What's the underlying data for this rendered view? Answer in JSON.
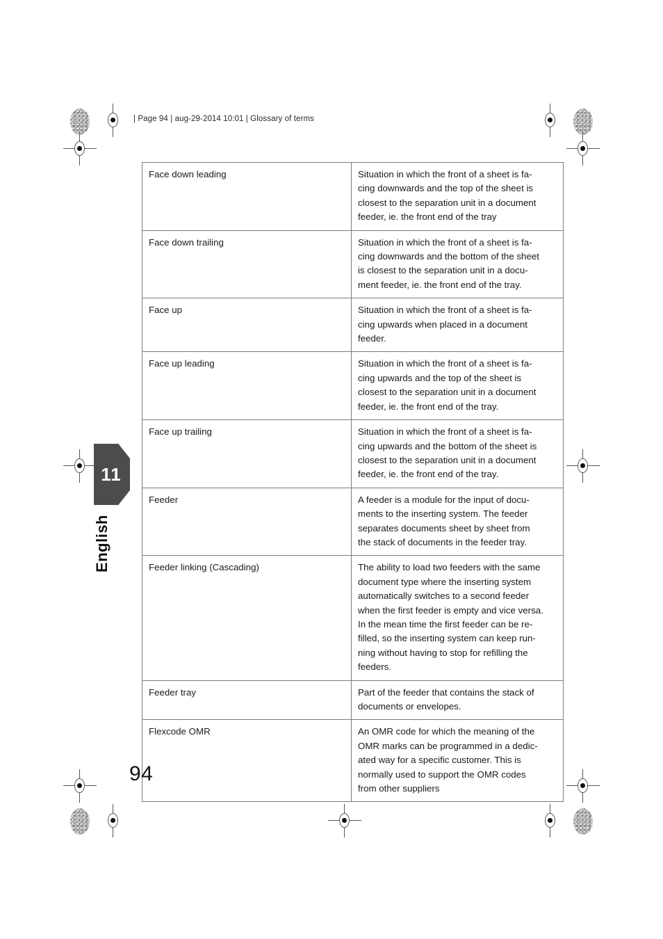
{
  "document": {
    "running_header": "|  Page 94 | aug-29-2014 10:01 | Glossary of terms",
    "page_number": "94",
    "chapter_number": "11",
    "language_tab": "English",
    "accent_color": "#4c4c4e",
    "rule_color": "#7c7c7c"
  },
  "glossary": {
    "rows": [
      {
        "term": "Face down leading",
        "definition_lines": [
          "Situation in which the front of a sheet is fa-",
          "cing downwards and the top of the sheet is",
          "closest to the separation unit in a document",
          "feeder, ie. the front end of the tray"
        ]
      },
      {
        "term": "Face down trailing",
        "definition_lines": [
          "Situation in which the front of a sheet is fa-",
          "cing downwards and the bottom of the sheet",
          "is closest to the separation unit in a docu-",
          "ment feeder, ie. the front end of the tray."
        ]
      },
      {
        "term": "Face up",
        "definition_lines": [
          "Situation in which the front of a sheet is fa-",
          "cing upwards when placed in a document",
          "feeder."
        ]
      },
      {
        "term": "Face up leading",
        "definition_lines": [
          "Situation in which the front of a sheet is fa-",
          "cing upwards and the top of the sheet is",
          "closest to the separation unit in a document",
          "feeder, ie. the front end of the tray."
        ]
      },
      {
        "term": "Face up trailing",
        "definition_lines": [
          "Situation in which the front of a sheet is fa-",
          "cing upwards and the bottom of the sheet is",
          "closest to the separation unit in a document",
          "feeder, ie. the front end of the tray."
        ]
      },
      {
        "term": "Feeder",
        "definition_lines": [
          "A feeder is a module for the input of docu-",
          "ments to the inserting system. The feeder",
          "separates documents sheet by sheet from",
          "the stack of documents in the feeder tray."
        ]
      },
      {
        "term": "Feeder linking (Cascading)",
        "definition_lines": [
          "The ability to load two feeders with the same",
          "document type where the inserting system",
          "automatically switches to a second feeder",
          "when the first feeder is empty and vice versa.",
          "In the mean time the first feeder can be re-",
          "filled, so the inserting system can keep run-",
          "ning without having to stop for refilling the",
          "feeders."
        ]
      },
      {
        "term": "Feeder tray",
        "definition_lines": [
          "Part of the feeder that contains the stack of",
          "documents or envelopes."
        ]
      },
      {
        "term": "Flexcode OMR",
        "definition_lines": [
          "An OMR code for which the meaning of the",
          "OMR marks can be programmed in a dedic-",
          "ated way for a specific customer. This is",
          "normally used to support the OMR codes",
          "from other suppliers"
        ]
      }
    ]
  },
  "print_marks": {
    "registration_target_label": "registration-target",
    "density_patch_label": "density-patch"
  }
}
